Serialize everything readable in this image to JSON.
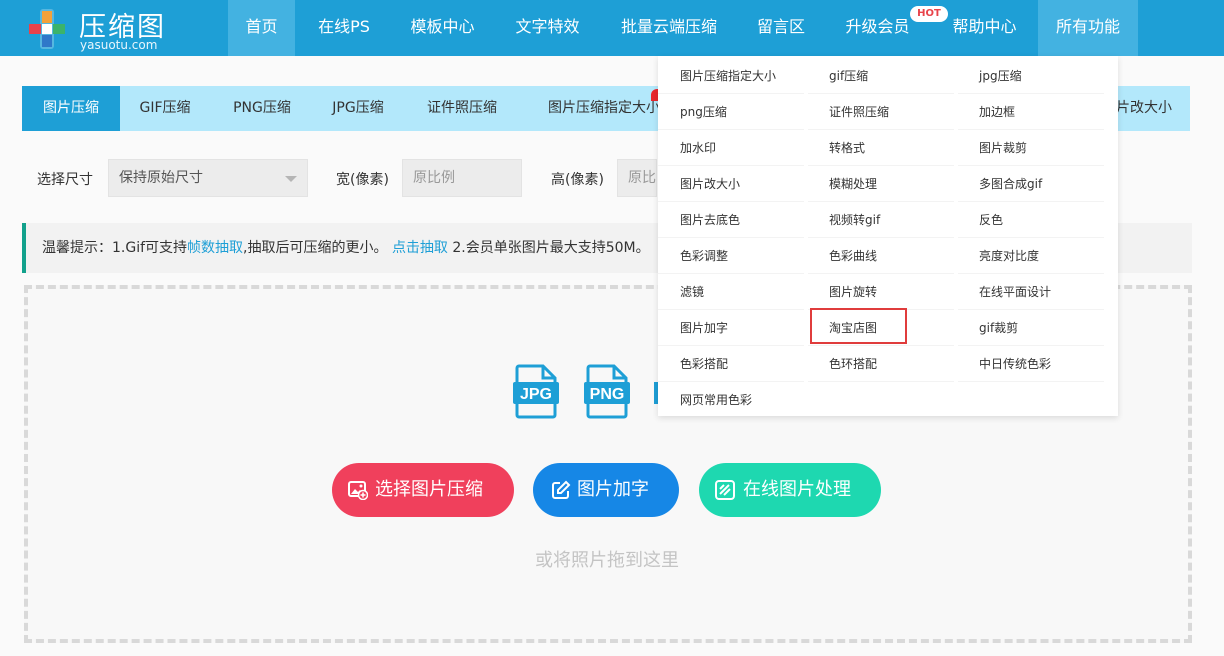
{
  "logo": {
    "name": "压缩图",
    "domain": "yasuotu.com"
  },
  "nav": {
    "items": [
      {
        "label": "首页"
      },
      {
        "label": "在线PS"
      },
      {
        "label": "模板中心"
      },
      {
        "label": "文字特效"
      },
      {
        "label": "批量云端压缩"
      },
      {
        "label": "留言区"
      },
      {
        "label": "升级会员"
      },
      {
        "label": "帮助中心"
      },
      {
        "label": "所有功能"
      }
    ],
    "hot_badge": "HOT"
  },
  "tabs": [
    {
      "label": "图片压缩"
    },
    {
      "label": "GIF压缩"
    },
    {
      "label": "PNG压缩"
    },
    {
      "label": "JPG压缩"
    },
    {
      "label": "证件照压缩"
    },
    {
      "label": "图片压缩指定大小"
    },
    {
      "label": "片改大小"
    }
  ],
  "size_row": {
    "select_label": "选择尺寸",
    "select_value": "保持原始尺寸",
    "width_label": "宽(像素)",
    "width_placeholder": "原比例",
    "height_label": "高(像素)",
    "height_placeholder": "原比例"
  },
  "tip": {
    "prefix": "温馨提示：1.Gif可支持",
    "link1": "帧数抽取",
    "middle": ",抽取后可压缩的更小。",
    "link2": "点击抽取",
    "suffix": " 2.会员单张图片最大支持50M。"
  },
  "dropzone": {
    "file_icons": [
      "JPG",
      "PNG"
    ],
    "buttons": {
      "compress": "选择图片压缩",
      "add_text": "图片加字",
      "online_edit": "在线图片处理"
    },
    "hint": "或将照片拖到这里"
  },
  "menu": {
    "columns": [
      [
        "图片压缩指定大小",
        "png压缩",
        "加水印",
        "图片改大小",
        "图片去底色",
        "色彩调整",
        "滤镜",
        "图片加字",
        "色彩搭配",
        "网页常用色彩"
      ],
      [
        "gif压缩",
        "证件照压缩",
        "转格式",
        "模糊处理",
        "视频转gif",
        "色彩曲线",
        "图片旋转",
        "淘宝店图",
        "色环搭配"
      ],
      [
        "jpg压缩",
        "加边框",
        "图片裁剪",
        "多图合成gif",
        "反色",
        "亮度对比度",
        "在线平面设计",
        "gif裁剪",
        "中日传统色彩"
      ]
    ]
  },
  "colors": {
    "nav_bg": "#1e9fd6",
    "tab_bg": "#b3e8fb",
    "btn_compress": "#f0405c",
    "btn_add_text": "#1687e6",
    "btn_online": "#1ed8b0",
    "highlight": "#e03c3c"
  },
  "icons": {
    "compress": "image-add-icon",
    "add_text": "edit-icon",
    "online": "online-edit-icon"
  }
}
